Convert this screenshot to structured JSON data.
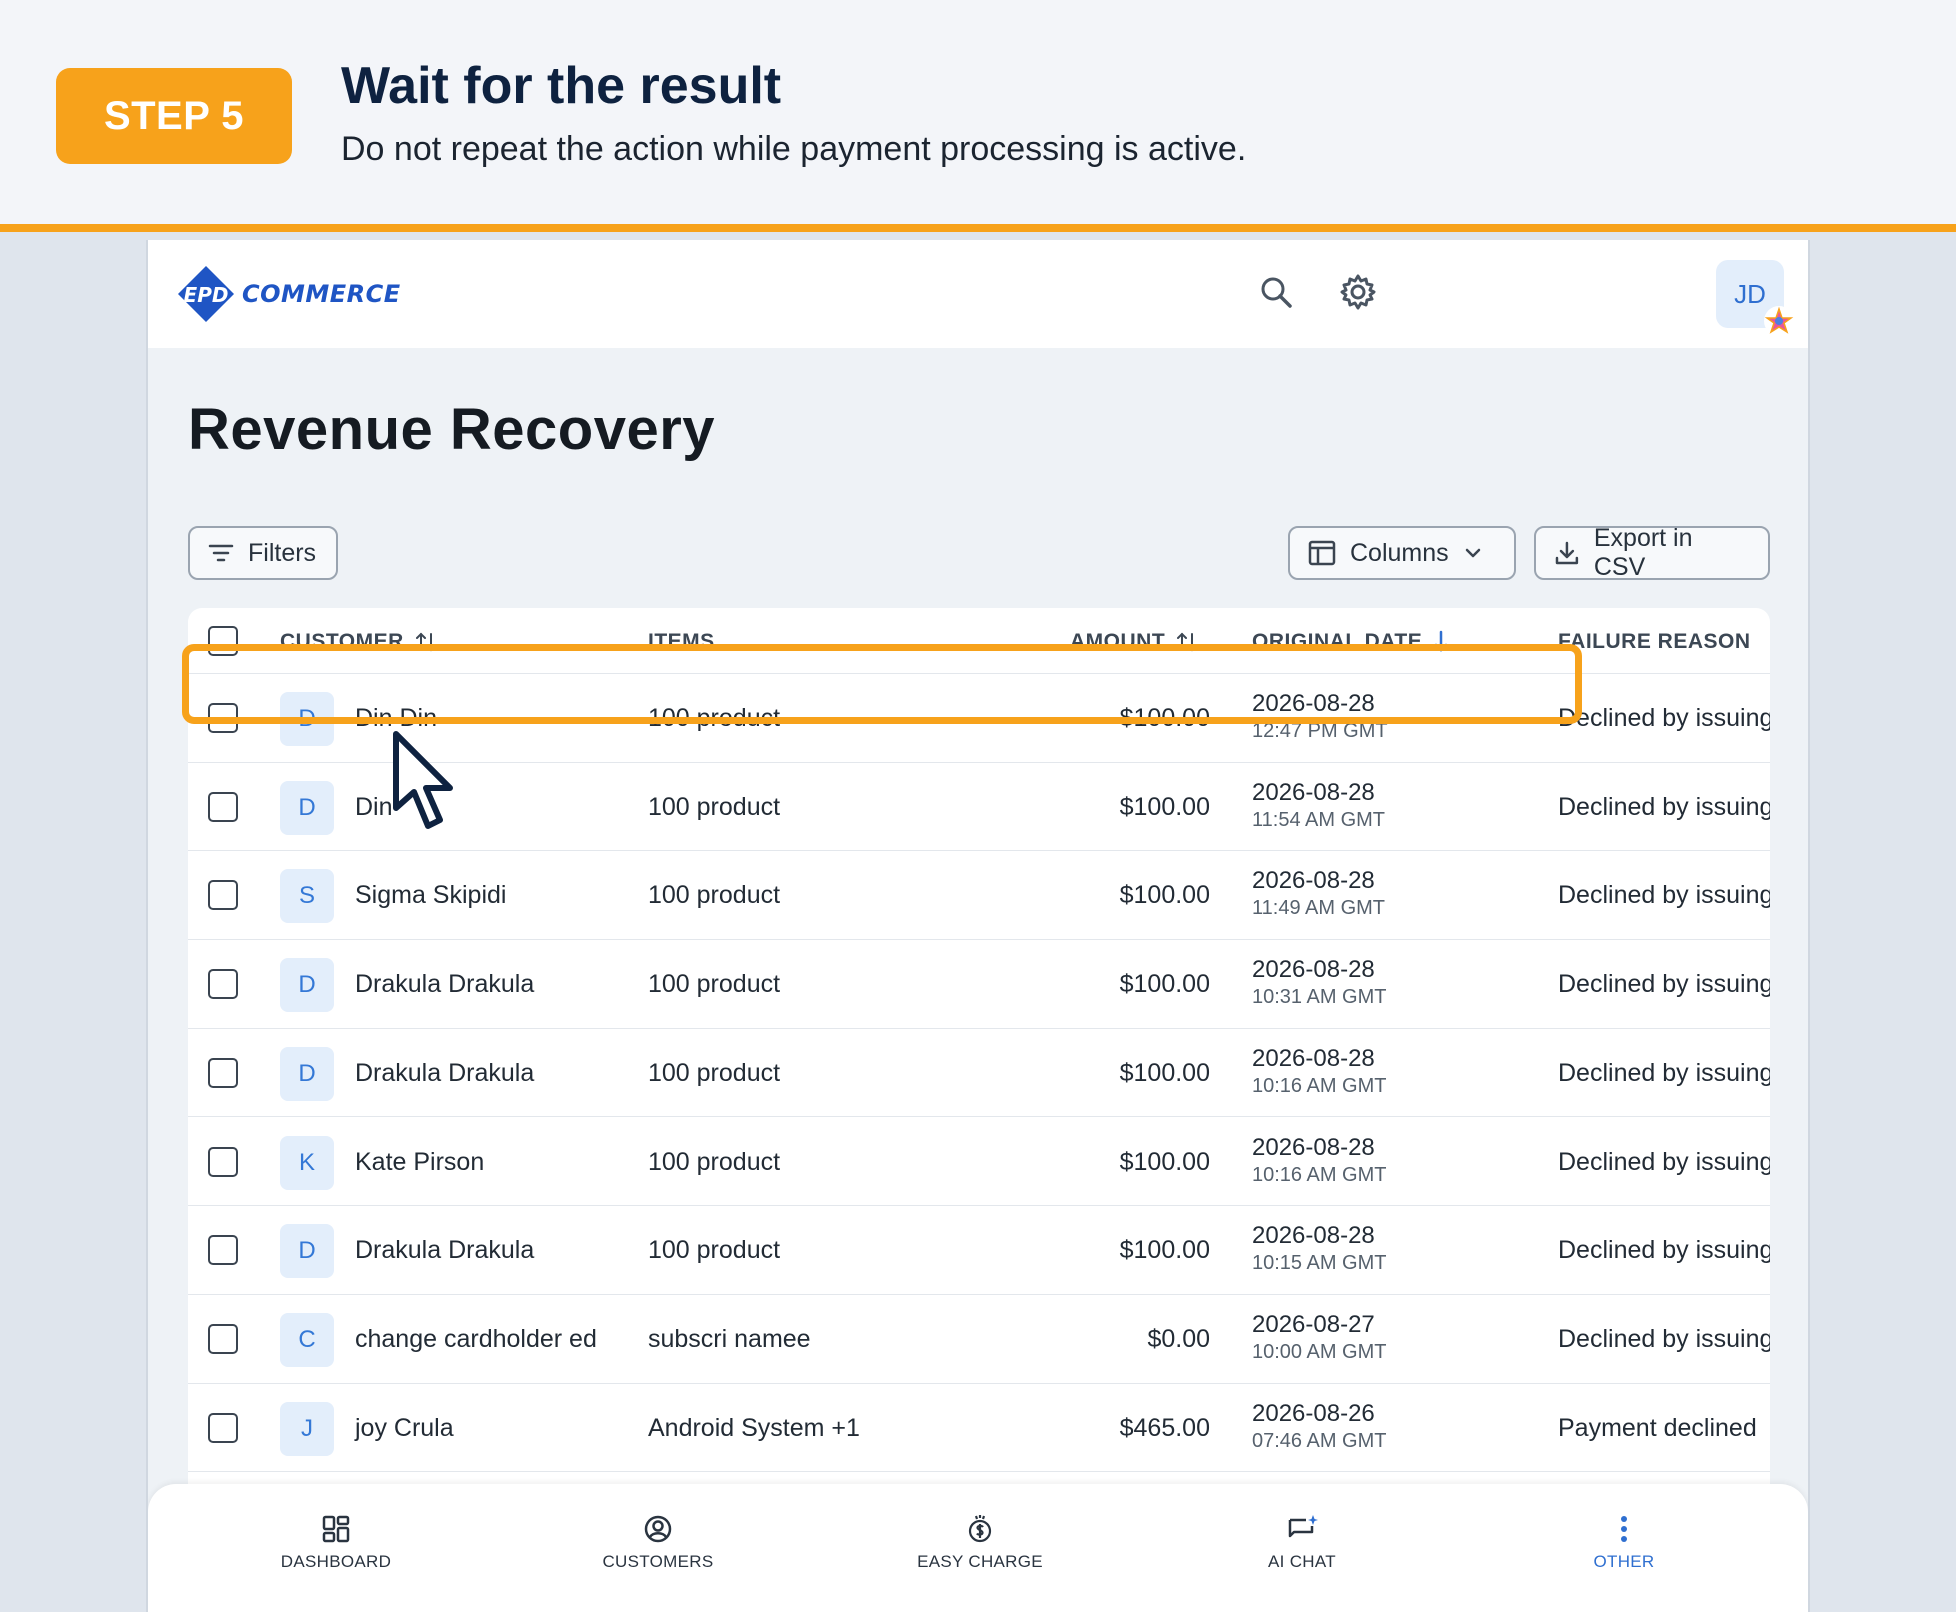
{
  "banner": {
    "step_label": "STEP 5",
    "title": "Wait for the result",
    "subtitle": "Do not repeat the action while payment processing is active."
  },
  "app": {
    "logo_text": "COMMERCE",
    "logo_mark": "EPD",
    "avatar_initials": "JD",
    "page_title": "Revenue Recovery",
    "toolbar": {
      "filters_label": "Filters",
      "columns_label": "Columns",
      "export_label": "Export in CSV"
    },
    "table": {
      "headers": {
        "customer": "CUSTOMER",
        "items": "ITEMS",
        "amount": "AMOUNT",
        "original_date": "ORIGINAL DATE",
        "failure_reason": "FAILURE REASON"
      },
      "rows": [
        {
          "initial": "D",
          "customer": "Din Din",
          "items": "100 product",
          "amount": "$100.00",
          "date": "2026-08-28",
          "time": "12:47 PM GMT",
          "reason": "Declined by issuing"
        },
        {
          "initial": "D",
          "customer": "Din",
          "items": "100 product",
          "amount": "$100.00",
          "date": "2026-08-28",
          "time": "11:54 AM GMT",
          "reason": "Declined by issuing"
        },
        {
          "initial": "S",
          "customer": "Sigma Skipidi",
          "items": "100 product",
          "amount": "$100.00",
          "date": "2026-08-28",
          "time": "11:49 AM GMT",
          "reason": "Declined by issuing"
        },
        {
          "initial": "D",
          "customer": "Drakula Drakula",
          "items": "100 product",
          "amount": "$100.00",
          "date": "2026-08-28",
          "time": "10:31 AM GMT",
          "reason": "Declined by issuing"
        },
        {
          "initial": "D",
          "customer": "Drakula Drakula",
          "items": "100 product",
          "amount": "$100.00",
          "date": "2026-08-28",
          "time": "10:16 AM GMT",
          "reason": "Declined by issuing"
        },
        {
          "initial": "K",
          "customer": "Kate Pirson",
          "items": "100 product",
          "amount": "$100.00",
          "date": "2026-08-28",
          "time": "10:16 AM GMT",
          "reason": "Declined by issuing"
        },
        {
          "initial": "D",
          "customer": "Drakula Drakula",
          "items": "100 product",
          "amount": "$100.00",
          "date": "2026-08-28",
          "time": "10:15 AM GMT",
          "reason": "Declined by issuing"
        },
        {
          "initial": "C",
          "customer": "change cardholder ed",
          "items": "subscri namee",
          "amount": "$0.00",
          "date": "2026-08-27",
          "time": "10:00 AM GMT",
          "reason": "Declined by issuing"
        },
        {
          "initial": "J",
          "customer": "joy Crula",
          "items": "Android System +1",
          "amount": "$465.00",
          "date": "2026-08-26",
          "time": "07:46 AM GMT",
          "reason": "Payment declined"
        }
      ]
    },
    "bottom_nav": [
      {
        "label": "DASHBOARD",
        "icon": "dashboard-icon"
      },
      {
        "label": "CUSTOMERS",
        "icon": "customers-icon"
      },
      {
        "label": "EASY CHARGE",
        "icon": "easy-charge-icon"
      },
      {
        "label": "AI CHAT",
        "icon": "ai-chat-icon"
      },
      {
        "label": "OTHER",
        "icon": "more-vertical-icon",
        "active": true
      }
    ]
  },
  "colors": {
    "accent_orange": "#f7a21b",
    "brand_blue": "#2f6fd0",
    "title_navy": "#0e2240"
  }
}
